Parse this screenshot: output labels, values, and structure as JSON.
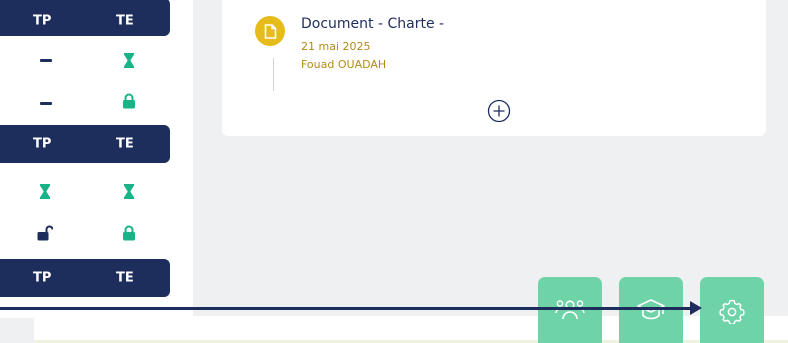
{
  "grid": {
    "col1_label": "TP",
    "col2_label": "TE",
    "header_top_partial": {
      "c1": "TP",
      "c2": "TE"
    },
    "rows_group1": [
      {
        "c1": "dash",
        "c2": "hourglass"
      },
      {
        "c1": "dash",
        "c2": "lock-closed"
      }
    ],
    "header_mid": {
      "c1": "TP",
      "c2": "TE"
    },
    "rows_group2": [
      {
        "c1": "hourglass",
        "c2": "hourglass"
      },
      {
        "c1": "lock-open",
        "c2": "lock-closed"
      }
    ],
    "header_bottom": {
      "c1": "TP",
      "c2": "TE"
    }
  },
  "document": {
    "title": "Document - Charte -",
    "date": "21 mai 2025",
    "author": "Fouad OUADAH",
    "icon": "document-icon"
  },
  "add_button": {
    "icon": "plus-circle-icon"
  },
  "fabs": [
    {
      "name": "users-button",
      "icon": "users-icon"
    },
    {
      "name": "education-button",
      "icon": "graduation-cap-icon"
    },
    {
      "name": "settings-button",
      "icon": "gear-icon"
    }
  ],
  "colors": {
    "navy": "#1d2d5c",
    "green": "#18b488",
    "fab_green": "#6ed3a7",
    "doc_yellow": "#e6bc1c",
    "meta_gold": "#b38a1a"
  }
}
